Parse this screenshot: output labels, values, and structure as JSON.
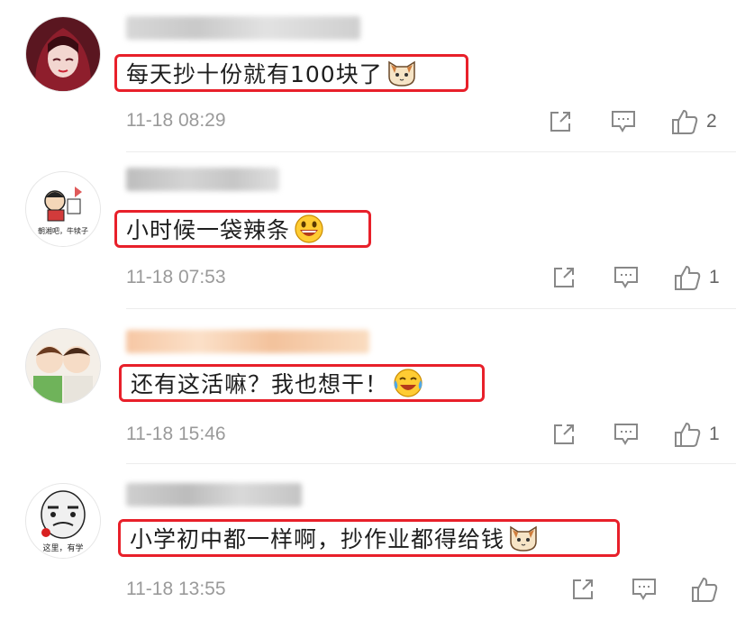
{
  "comments": [
    {
      "text": "每天抄十份就有100块了",
      "time": "11-18 08:29",
      "likes": "2",
      "emoji": "cat-face"
    },
    {
      "text": "小时候一袋辣条",
      "time": "11-18 07:53",
      "likes": "1",
      "emoji": "grinning-face"
    },
    {
      "text": "还有这活嘛？我也想干！",
      "time": "11-18 15:46",
      "likes": "1",
      "emoji": "laughing-crying-face"
    },
    {
      "text": "小学初中都一样啊，抄作业都得给钱",
      "time": "11-18 13:55",
      "likes": "",
      "emoji": "cat-face"
    }
  ],
  "avatar_captions": {
    "second": "朝湘吧，牛犊子",
    "fourth": "这里，有学"
  },
  "colors": {
    "highlight_border": "#e8202a",
    "timestamp": "#9a9a9a",
    "icon": "#888888"
  }
}
